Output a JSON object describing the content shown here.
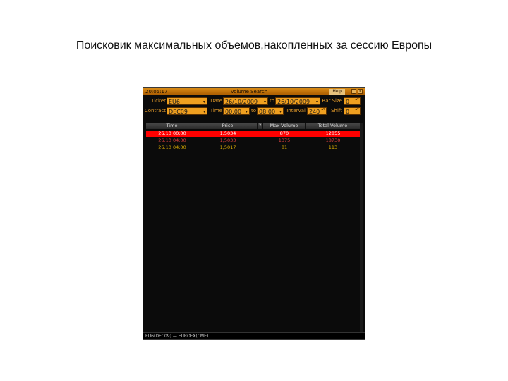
{
  "slide": {
    "title": "Поисковик максимальных объемов,накопленных за сессию Европы"
  },
  "window": {
    "clock": "20:05:17",
    "title": "Volume Search",
    "help_label": "Help",
    "min_glyph": "_",
    "close_glyph": "×"
  },
  "controls": {
    "ticker_label": "Ticker",
    "ticker_value": "EU6",
    "date_label": "Date",
    "date_from": "26/10/2009",
    "to_label1": "to",
    "date_to": "26/10/2009",
    "barsize_label": "Bar Size",
    "barsize_value": "0",
    "contract_label": "Contract",
    "contract_value": "DEC09",
    "time_label": "Time",
    "time_from": "00:00",
    "to_label2": "to",
    "time_to": "08:00",
    "interval_label": "Interval",
    "interval_value": "240",
    "shift_label": "Shift",
    "shift_value": "0",
    "dropdown_glyph": "▾",
    "spin_glyph": "▴▾"
  },
  "table": {
    "columns": [
      "Time",
      "Price",
      "?",
      "Max Volume",
      "Total Volume"
    ],
    "rows": [
      [
        "26.10 00:00",
        "1,5034",
        "",
        "870",
        "12855"
      ],
      [
        "26.10 04:00",
        "1,5033",
        "",
        "1375",
        "18730"
      ],
      [
        "26.10 04:00",
        "1,5017",
        "",
        "81",
        "113"
      ]
    ]
  },
  "status": {
    "text": "EU6(DEC09) — EUROFX(CME)"
  },
  "colors": {
    "accent": "#f0a020",
    "selected_row": "#ff0000",
    "background": "#0b0b0b"
  }
}
